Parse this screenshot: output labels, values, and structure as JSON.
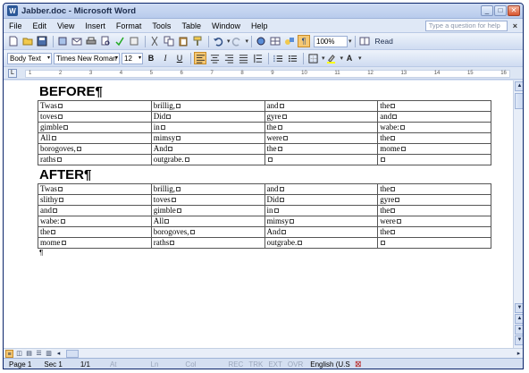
{
  "window": {
    "title": "Jabber.doc - Microsoft Word",
    "buttons": [
      "_",
      "□",
      "✕"
    ]
  },
  "menubar": {
    "items": [
      "File",
      "Edit",
      "View",
      "Insert",
      "Format",
      "Tools",
      "Table",
      "Window",
      "Help"
    ],
    "help_placeholder": "Type a question for help",
    "close": "×"
  },
  "toolbar": {
    "zoom": "100%",
    "read_label": "Read"
  },
  "formatting": {
    "style": "Body Text",
    "font": "Times New Roman",
    "size": "12"
  },
  "ruler": {
    "ticks": [
      "1",
      "2",
      "3",
      "4",
      "5",
      "6",
      "7",
      "8",
      "9",
      "10",
      "11",
      "12",
      "13",
      "14",
      "15",
      "16"
    ]
  },
  "document": {
    "before_heading": "BEFORE¶",
    "after_heading": "AFTER¶",
    "before_rows": [
      [
        "Twas",
        "brillig,",
        "and",
        "the"
      ],
      [
        "toves",
        "Did",
        "gyre",
        "and"
      ],
      [
        "gimble",
        "in",
        "the",
        "wabe:"
      ],
      [
        "All",
        "mimsy",
        "were",
        "the"
      ],
      [
        "borogoves,",
        "And",
        "the",
        "mome"
      ],
      [
        "raths",
        "outgrabe.",
        "",
        ""
      ]
    ],
    "after_rows": [
      [
        "Twas",
        "brillig,",
        "and",
        "the"
      ],
      [
        "slithy",
        "toves",
        "Did",
        "gyre"
      ],
      [
        "and",
        "gimble",
        "in",
        "the"
      ],
      [
        "wabe:",
        "All",
        "mimsy",
        "were"
      ],
      [
        "the",
        "borogoves,",
        "And",
        "the"
      ],
      [
        "mome",
        "raths",
        "outgrabe.",
        ""
      ]
    ],
    "end_para": "¶"
  },
  "statusbar": {
    "page": "Page 1",
    "sec": "Sec 1",
    "pages": "1/1",
    "at": "At",
    "ln": "Ln",
    "col": "Col",
    "rec": "REC",
    "trk": "TRK",
    "ext": "EXT",
    "ovr": "OVR",
    "language": "English (U.S"
  },
  "colors": {
    "title_bg": "#cfdcf3",
    "accent": "#f5c873"
  }
}
